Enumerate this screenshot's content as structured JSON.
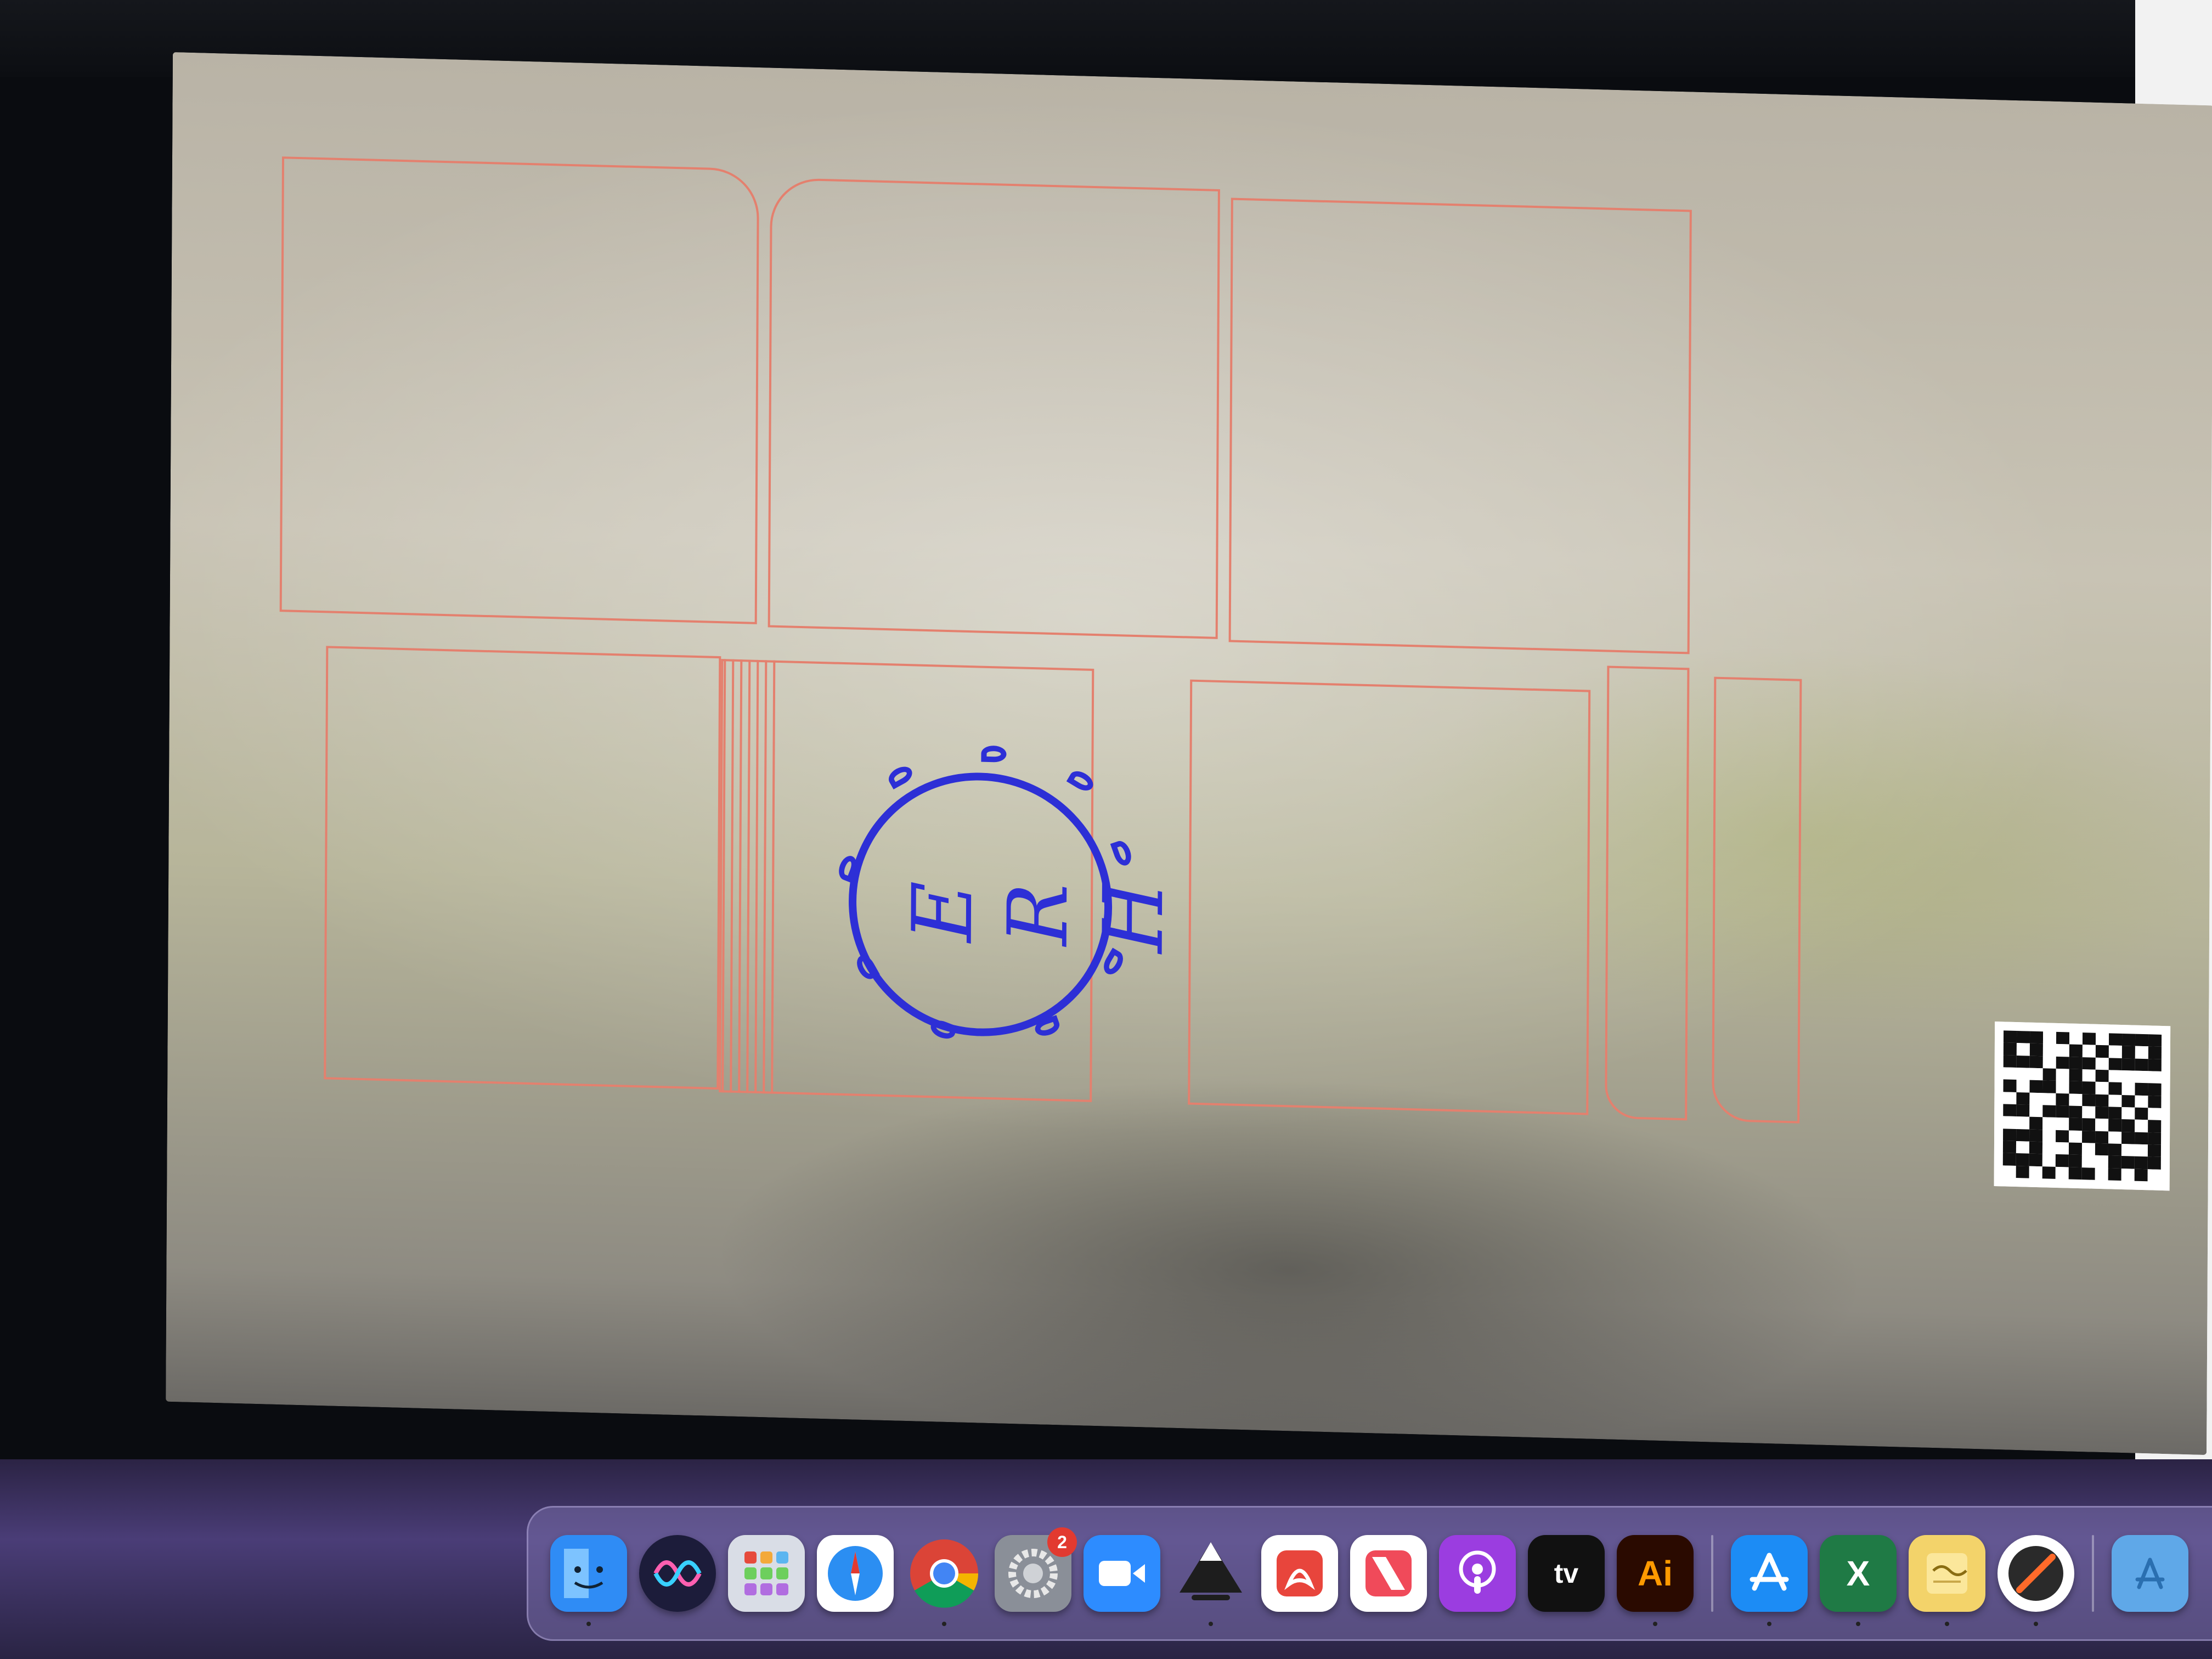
{
  "camera": {
    "engraving_text": [
      "E",
      "R",
      "H"
    ]
  },
  "colors": {
    "cut_line": "#e4806e",
    "engrave_line": "#2d2fd6"
  },
  "dock": {
    "items": [
      {
        "name": "finder-icon",
        "color": "#2f8cf5",
        "label": "",
        "running": true
      },
      {
        "name": "siri-icon",
        "color": "#1c1c3a",
        "label": "",
        "running": false
      },
      {
        "name": "launchpad-icon",
        "color": "#d9dde6",
        "label": "",
        "running": false
      },
      {
        "name": "safari-icon",
        "color": "#2b8ef2",
        "label": "",
        "running": false
      },
      {
        "name": "chrome-icon",
        "color": "#ffffff",
        "label": "",
        "running": true
      },
      {
        "name": "system-preferences-icon",
        "color": "#8a8f98",
        "label": "",
        "badge": "2",
        "running": false
      },
      {
        "name": "zoom-icon",
        "color": "#2d8cff",
        "label": "",
        "running": false
      },
      {
        "name": "inkscape-icon",
        "color": "#1d1d1d",
        "label": "",
        "running": true
      },
      {
        "name": "acrobat-icon",
        "color": "#e8453c",
        "label": "",
        "running": false
      },
      {
        "name": "news-icon",
        "color": "#f04a5a",
        "label": "",
        "running": false
      },
      {
        "name": "podcasts-icon",
        "color": "#9b3de0",
        "label": "",
        "running": false
      },
      {
        "name": "apple-tv-icon",
        "color": "#111111",
        "label": "tv",
        "running": false
      },
      {
        "name": "illustrator-icon",
        "color": "#2a0a00",
        "label": "Ai",
        "running": true
      },
      {
        "name": "app-store-icon",
        "color": "#1c8cf5",
        "label": "",
        "running": true
      },
      {
        "name": "excel-icon",
        "color": "#1f7a45",
        "label": "X",
        "running": true
      },
      {
        "name": "notes-icon",
        "color": "#f3d36a",
        "label": "",
        "running": true
      },
      {
        "name": "lightburn-icon",
        "color": "#2a2a2a",
        "label": "",
        "running": true
      },
      {
        "name": "applications-folder-icon",
        "color": "#5fa8e8",
        "label": "",
        "running": false
      }
    ]
  }
}
